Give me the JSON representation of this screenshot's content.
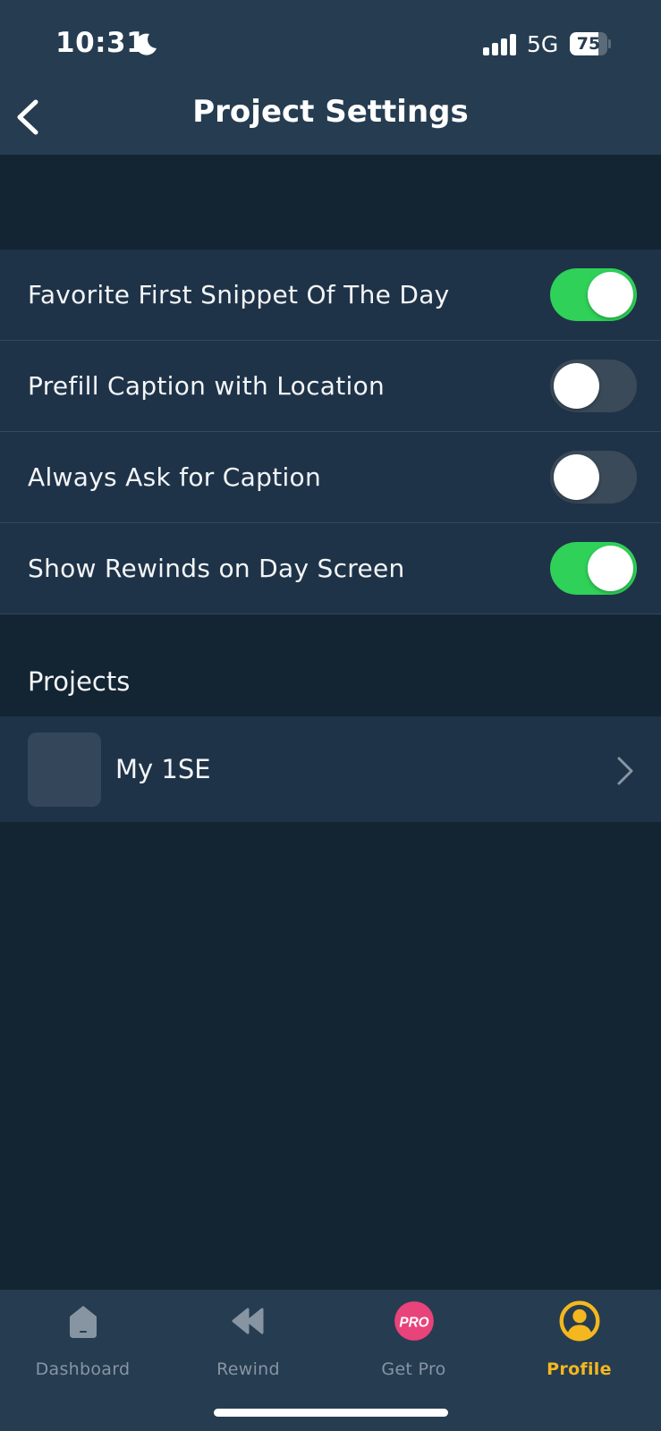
{
  "status_bar": {
    "time": "10:31",
    "network": "5G",
    "battery": "75",
    "battery_level_percent": 75
  },
  "header": {
    "title": "Project Settings",
    "back_icon": "chevron-left-icon"
  },
  "settings": [
    {
      "label": "Favorite First Snippet Of The Day",
      "enabled": true
    },
    {
      "label": "Prefill Caption with Location",
      "enabled": false
    },
    {
      "label": "Always Ask for Caption",
      "enabled": false
    },
    {
      "label": "Show Rewinds on Day Screen",
      "enabled": true
    }
  ],
  "projects": {
    "section_title": "Projects",
    "items": [
      {
        "name": "My 1SE"
      }
    ]
  },
  "tab_bar": {
    "tabs": [
      {
        "label": "Dashboard",
        "icon": "home-icon",
        "active": false
      },
      {
        "label": "Rewind",
        "icon": "rewind-icon",
        "active": false
      },
      {
        "label": "Get Pro",
        "icon": "pro-badge-icon",
        "icon_text": "PRO",
        "active": false
      },
      {
        "label": "Profile",
        "icon": "profile-icon",
        "active": true
      }
    ]
  },
  "colors": {
    "header_bg": "#263c51",
    "page_bg": "#132433",
    "row_bg": "#1f3348",
    "toggle_on": "#2fd158",
    "toggle_off": "#3a4a59",
    "accent_active": "#f4b71e",
    "pro_badge": "#e8437a",
    "inactive_tab": "#8795a3"
  }
}
